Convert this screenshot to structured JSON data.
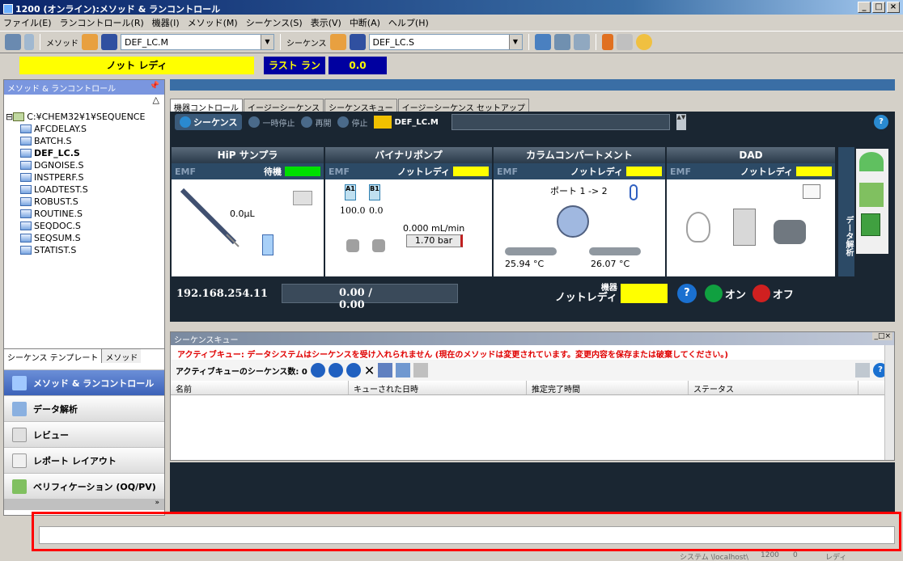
{
  "window": {
    "title": "1200 (オンライン):メソッド & ランコントロール"
  },
  "menu": [
    "ファイル(E)",
    "ランコントロール(R)",
    "機器(I)",
    "メソッド(M)",
    "シーケンス(S)",
    "表示(V)",
    "中断(A)",
    "ヘルプ(H)"
  ],
  "toolbar": {
    "method_label": "メソッド",
    "method_value": "DEF_LC.M",
    "sequence_label": "シーケンス",
    "sequence_value": "DEF_LC.S"
  },
  "status": {
    "state": "ノット レディ",
    "last_run_label": "ラスト ラン",
    "last_run_value": "0.0"
  },
  "left_pane": {
    "header": "メソッド & ランコントロール",
    "root": "C:¥CHEM32¥1¥SEQUENCE",
    "files": [
      "AFCDELAY.S",
      "BATCH.S",
      "DEF_LC.S",
      "DGNOISE.S",
      "INSTPERF.S",
      "LOADTEST.S",
      "ROBUST.S",
      "ROUTINE.S",
      "SEQDOC.S",
      "SEQSUM.S",
      "STATIST.S"
    ],
    "selected": "DEF_LC.S",
    "tabs": [
      "シーケンス テンプレート",
      "メソッド"
    ]
  },
  "nav": [
    "メソッド & ランコントロール",
    "データ解析",
    "レビュー",
    "レポート レイアウト",
    "ベリフィケーション (OQ/PV)"
  ],
  "tabs": [
    "機器コントロール",
    "イージーシーケンス",
    "シーケンスキュー",
    "イージーシーケンス セットアップ"
  ],
  "instrument": {
    "buttons": [
      "シーケンス",
      "一時停止",
      "再開",
      "停止"
    ],
    "method": "DEF_LC.M",
    "modules": [
      {
        "name": "HiP サンプラ",
        "status": "待機",
        "emf": "EMF",
        "volume": "0.0µL"
      },
      {
        "name": "バイナリポンプ",
        "status": "ノットレディ",
        "emf": "EMF",
        "a_label": "A1",
        "b_label": "B1",
        "a": "100.0",
        "b": "0.0",
        "flow": "0.000 mL/min",
        "pressure": "1.70 bar"
      },
      {
        "name": "カラムコンパートメント",
        "status": "ノットレディ",
        "emf": "EMF",
        "port": "ポート 1 -> 2",
        "temp_left": "25.94 °C",
        "temp_right": "26.07 °C"
      },
      {
        "name": "DAD",
        "status": "ノットレディ",
        "emf": "EMF"
      }
    ],
    "side_label": "データ解析",
    "ip": "192.168.254.11",
    "counter": "0.00 / 0.00",
    "device_label": "機器",
    "device_status": "ノットレディ",
    "on": "オン",
    "off": "オフ"
  },
  "queue": {
    "title": "シーケンスキュー",
    "warning": "アクティブキュー: データシステムはシーケンスを受け入れられません (現在のメソッドは変更されています。変更内容を保存または破棄してください。)",
    "count_label": "アクティブキューのシーケンス数: 0",
    "columns": [
      "名前",
      "キューされた日時",
      "推定完了時間",
      "ステータス"
    ]
  },
  "system_bar": {
    "system": "システム \\localhost\\",
    "instrument": "1200",
    "count": "0",
    "ready": "レディ"
  }
}
